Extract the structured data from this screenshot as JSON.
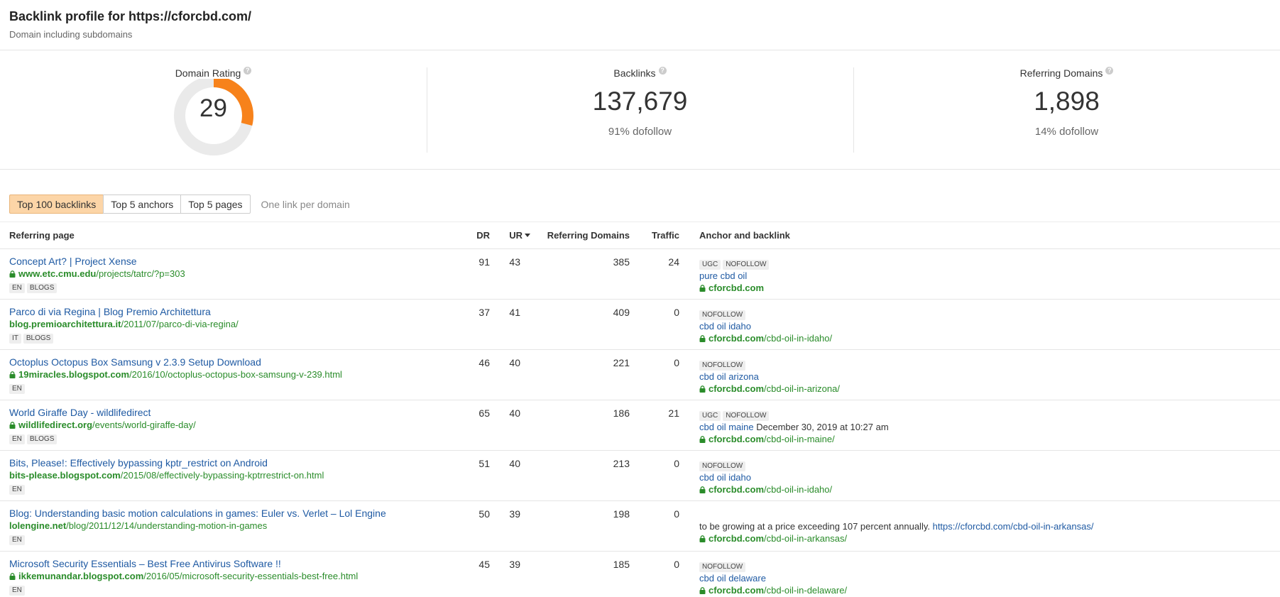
{
  "header": {
    "title": "Backlink profile for https://cforcbd.com/",
    "subtitle": "Domain including subdomains"
  },
  "stats": {
    "domain_rating": {
      "label": "Domain Rating",
      "value": "29",
      "fraction": 0.29,
      "color": "#f7821b"
    },
    "backlinks": {
      "label": "Backlinks",
      "value": "137,679",
      "note": "91% dofollow"
    },
    "referring_domains": {
      "label": "Referring Domains",
      "value": "1,898",
      "note": "14% dofollow"
    }
  },
  "tabs": {
    "items": [
      "Top 100 backlinks",
      "Top 5 anchors",
      "Top 5 pages"
    ],
    "note": "One link per domain"
  },
  "table": {
    "headers": {
      "page": "Referring page",
      "dr": "DR",
      "ur": "UR",
      "rd": "Referring Domains",
      "traffic": "Traffic",
      "anchor": "Anchor and backlink"
    },
    "rows": [
      {
        "title": "Concept Art? | Project Xense",
        "secure": true,
        "domain": "www.etc.cmu.edu",
        "path": "/projects/tatrc/?p=303",
        "tags": [
          "EN",
          "BLOGS"
        ],
        "dr": "91",
        "ur": "43",
        "rd": "385",
        "traffic": "24",
        "badges": [
          "UGC",
          "NOFOLLOW"
        ],
        "anchor": "pure cbd oil",
        "anchor_extra": "",
        "target_domain": "cforcbd.com",
        "target_path": ""
      },
      {
        "title": "Parco di via Regina | Blog Premio Architettura",
        "secure": false,
        "domain": "blog.premioarchitettura.it",
        "path": "/2011/07/parco-di-via-regina/",
        "tags": [
          "IT",
          "BLOGS"
        ],
        "dr": "37",
        "ur": "41",
        "rd": "409",
        "traffic": "0",
        "badges": [
          "NOFOLLOW"
        ],
        "anchor": "cbd oil idaho",
        "anchor_extra": "",
        "target_domain": "cforcbd.com",
        "target_path": "/cbd-oil-in-idaho/"
      },
      {
        "title": "Octoplus Octopus Box Samsung v 2.3.9 Setup Download",
        "secure": true,
        "domain": "19miracles.blogspot.com",
        "path": "/2016/10/octoplus-octopus-box-samsung-v-239.html",
        "tags": [
          "EN"
        ],
        "dr": "46",
        "ur": "40",
        "rd": "221",
        "traffic": "0",
        "badges": [
          "NOFOLLOW"
        ],
        "anchor": "cbd oil arizona",
        "anchor_extra": "",
        "target_domain": "cforcbd.com",
        "target_path": "/cbd-oil-in-arizona/"
      },
      {
        "title": "World Giraffe Day - wildlifedirect",
        "secure": true,
        "domain": "wildlifedirect.org",
        "path": "/events/world-giraffe-day/",
        "tags": [
          "EN",
          "BLOGS"
        ],
        "dr": "65",
        "ur": "40",
        "rd": "186",
        "traffic": "21",
        "badges": [
          "UGC",
          "NOFOLLOW"
        ],
        "anchor": "cbd oil maine",
        "anchor_extra": " December 30, 2019 at 10:27 am",
        "target_domain": "cforcbd.com",
        "target_path": "/cbd-oil-in-maine/"
      },
      {
        "title": "Bits, Please!: Effectively bypassing kptr_restrict on Android",
        "secure": false,
        "domain": "bits-please.blogspot.com",
        "path": "/2015/08/effectively-bypassing-kptrrestrict-on.html",
        "tags": [
          "EN"
        ],
        "dr": "51",
        "ur": "40",
        "rd": "213",
        "traffic": "0",
        "badges": [
          "NOFOLLOW"
        ],
        "anchor": "cbd oil idaho",
        "anchor_extra": "",
        "target_domain": "cforcbd.com",
        "target_path": "/cbd-oil-in-idaho/"
      },
      {
        "title": "Blog: Understanding basic motion calculations in games: Euler vs. Verlet – Lol Engine",
        "secure": false,
        "domain": "lolengine.net",
        "path": "/blog/2011/12/14/understanding-motion-in-games",
        "tags": [
          "EN"
        ],
        "dr": "50",
        "ur": "39",
        "rd": "198",
        "traffic": "0",
        "badges": [],
        "context": "to be growing at a price exceeding 107 percent annually. ",
        "anchor": "https://cforcbd.com/cbd-oil-in-arkansas/",
        "anchor_extra": "",
        "target_domain": "cforcbd.com",
        "target_path": "/cbd-oil-in-arkansas/"
      },
      {
        "title": "Microsoft Security Essentials – Best Free Antivirus Software !!",
        "secure": true,
        "domain": "ikkemunandar.blogspot.com",
        "path": "/2016/05/microsoft-security-essentials-best-free.html",
        "tags": [
          "EN"
        ],
        "dr": "45",
        "ur": "39",
        "rd": "185",
        "traffic": "0",
        "badges": [
          "NOFOLLOW"
        ],
        "anchor": "cbd oil delaware",
        "anchor_extra": "",
        "target_domain": "cforcbd.com",
        "target_path": "/cbd-oil-in-delaware/"
      }
    ]
  }
}
